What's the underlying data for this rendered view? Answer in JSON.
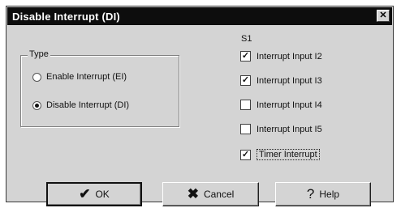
{
  "window": {
    "title": "Disable Interrupt (DI)",
    "close_glyph": "✕",
    "close_icon": "close-icon"
  },
  "type_group": {
    "legend": "Type",
    "options": [
      {
        "label": "Enable Interrupt (EI)",
        "selected": false
      },
      {
        "label": "Disable Interrupt (DI)",
        "selected": true
      }
    ]
  },
  "s1_group": {
    "label": "S1",
    "items": [
      {
        "label": "Interrupt Input I2",
        "checked": true,
        "glyph": "✓"
      },
      {
        "label": "Interrupt Input I3",
        "checked": true,
        "glyph": "✓"
      },
      {
        "label": "Interrupt Input I4",
        "checked": false,
        "glyph": ""
      },
      {
        "label": "Interrupt Input I5",
        "checked": false,
        "glyph": ""
      },
      {
        "label": "Timer Interrupt",
        "checked": true,
        "glyph": "✓"
      }
    ]
  },
  "buttons": {
    "ok": {
      "label": "OK",
      "glyph": "✔",
      "icon": "checkmark-icon"
    },
    "cancel": {
      "label": "Cancel",
      "glyph": "✖",
      "icon": "x-icon"
    },
    "help": {
      "label": "Help",
      "glyph": "?",
      "icon": "question-mark-icon"
    }
  }
}
